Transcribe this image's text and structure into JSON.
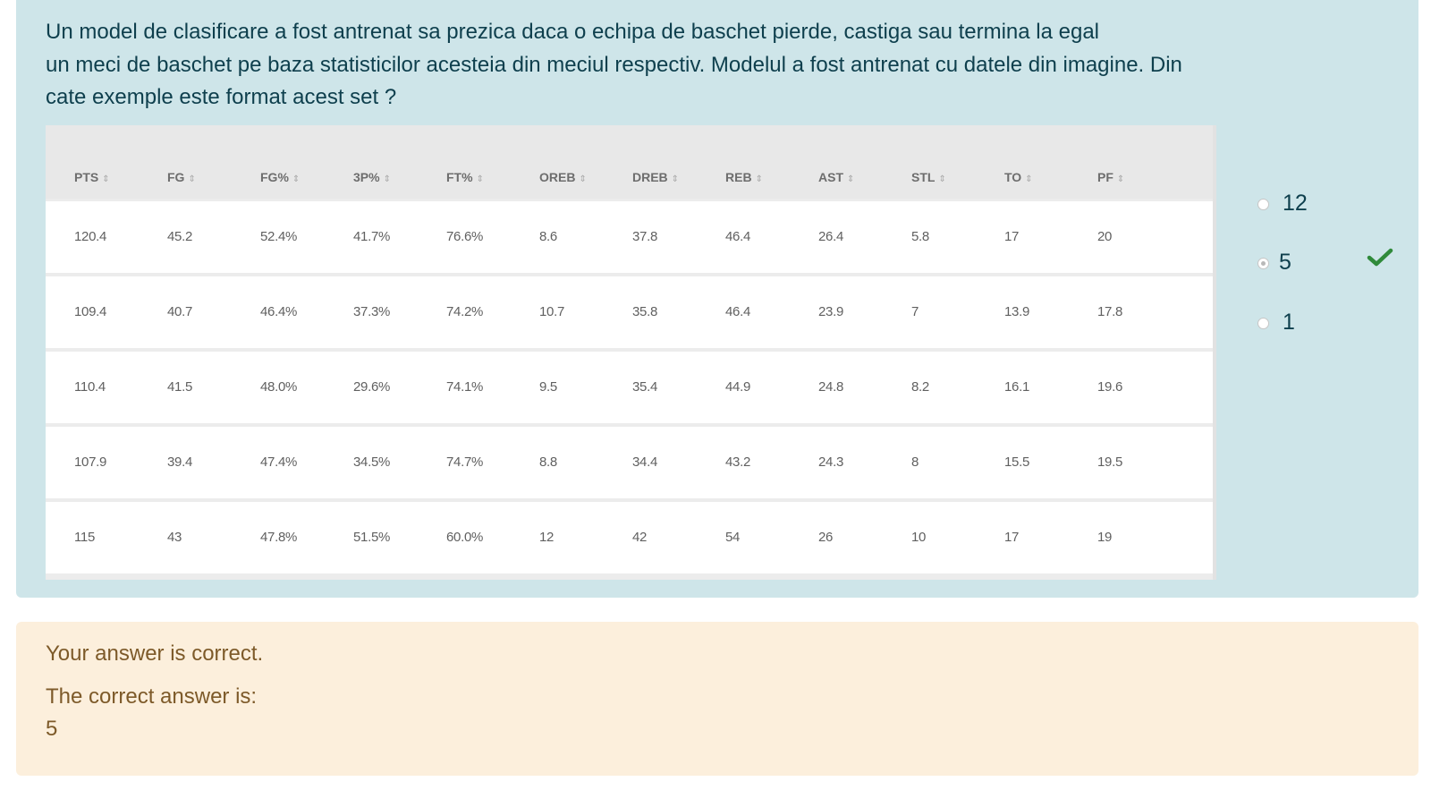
{
  "question": {
    "lines": [
      "Un model de clasificare a fost antrenat sa prezica daca o echipa de baschet pierde, castiga sau termina la egal",
      "un meci de baschet pe baza statisticilor acesteia din meciul respectiv. Modelul a fost antrenat cu datele din imagine. Din",
      "cate exemple este format acest set ?"
    ]
  },
  "table": {
    "sort_glyph": "⇕",
    "headers": [
      "PTS",
      "FG",
      "FG%",
      "3P%",
      "FT%",
      "OREB",
      "DREB",
      "REB",
      "AST",
      "STL",
      "TO",
      "PF"
    ],
    "rows": [
      [
        "120.4",
        "45.2",
        "52.4%",
        "41.7%",
        "76.6%",
        "8.6",
        "37.8",
        "46.4",
        "26.4",
        "5.8",
        "17",
        "20"
      ],
      [
        "109.4",
        "40.7",
        "46.4%",
        "37.3%",
        "74.2%",
        "10.7",
        "35.8",
        "46.4",
        "23.9",
        "7",
        "13.9",
        "17.8"
      ],
      [
        "110.4",
        "41.5",
        "48.0%",
        "29.6%",
        "74.1%",
        "9.5",
        "35.4",
        "44.9",
        "24.8",
        "8.2",
        "16.1",
        "19.6"
      ],
      [
        "107.9",
        "39.4",
        "47.4%",
        "34.5%",
        "74.7%",
        "8.8",
        "34.4",
        "43.2",
        "24.3",
        "8",
        "15.5",
        "19.5"
      ],
      [
        "115",
        "43",
        "47.8%",
        "51.5%",
        "60.0%",
        "12",
        "42",
        "54",
        "26",
        "10",
        "17",
        "19"
      ]
    ]
  },
  "options": [
    {
      "label": "12",
      "selected": false,
      "correct": false
    },
    {
      "label": "5",
      "selected": true,
      "correct": true
    },
    {
      "label": "1",
      "selected": false,
      "correct": false
    }
  ],
  "feedback": {
    "status": "Your answer is correct.",
    "correct_intro": "The correct answer is:",
    "correct_value": "5"
  },
  "colors": {
    "question_bg": "#cee5e9",
    "question_text": "#0e3f4d",
    "feedback_bg": "#fcefdc",
    "feedback_text": "#7d5a29",
    "check_green": "#2f8a3a"
  }
}
